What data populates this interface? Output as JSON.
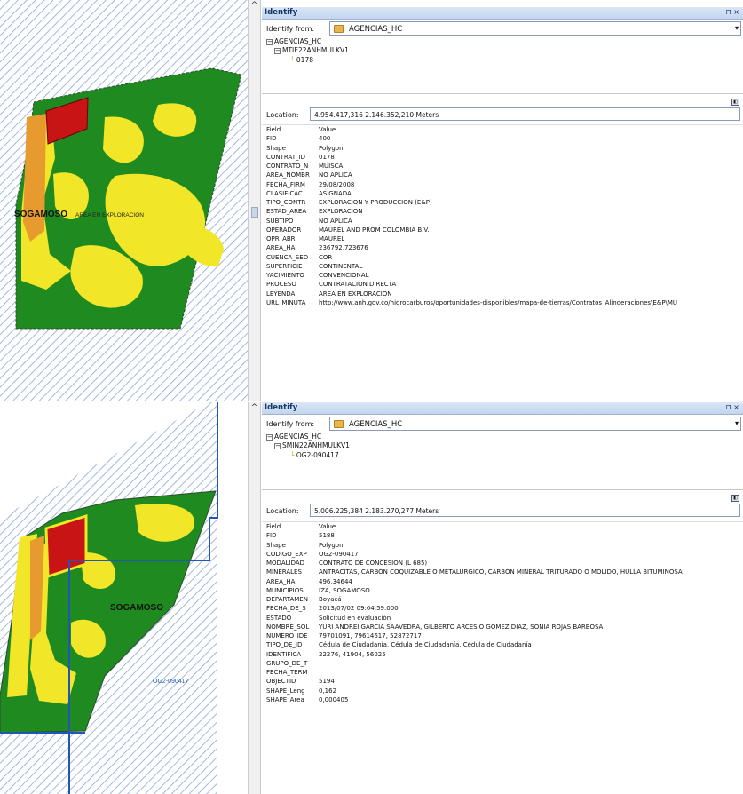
{
  "top": {
    "map": {
      "place_label": "SOGAMOSO",
      "area_label": "AREA EN EXPLORACION"
    },
    "panel": {
      "title": "Identify",
      "pin": "⊓ ×",
      "identify_from_label": "Identify from:",
      "identify_from_value": "AGENCIAS_HC",
      "tree": {
        "root": "AGENCIAS_HC",
        "child": "MTIE22ANHMULKV1",
        "leaf": "0178"
      },
      "location_label": "Location:",
      "location_value": "4.954.417,316  2.146.352,210 Meters",
      "grid_header": {
        "field": "Field",
        "value": "Value"
      },
      "rows": [
        {
          "field": "FID",
          "value": "400"
        },
        {
          "field": "Shape",
          "value": "Polygon"
        },
        {
          "field": "CONTRAT_ID",
          "value": "0178"
        },
        {
          "field": "CONTRATO_N",
          "value": "MUISCA"
        },
        {
          "field": "AREA_NOMBR",
          "value": "NO APLICA"
        },
        {
          "field": "FECHA_FIRM",
          "value": "29/08/2008"
        },
        {
          "field": "CLASIFICAC",
          "value": "ASIGNADA"
        },
        {
          "field": "TIPO_CONTR",
          "value": "EXPLORACION Y PRODUCCION (E&P)"
        },
        {
          "field": "ESTAD_AREA",
          "value": "EXPLORACION"
        },
        {
          "field": "SUBTIPO",
          "value": "NO APLICA"
        },
        {
          "field": "OPERADOR",
          "value": "MAUREL AND PROM COLOMBIA B.V."
        },
        {
          "field": "OPR_ABR",
          "value": "MAUREL"
        },
        {
          "field": "AREA_HA",
          "value": "236792,723676"
        },
        {
          "field": "CUENCA_SED",
          "value": "COR"
        },
        {
          "field": "SUPERFICIE",
          "value": "CONTINENTAL"
        },
        {
          "field": "YACIMIENTO",
          "value": "CONVENCIONAL"
        },
        {
          "field": "PROCESO",
          "value": "CONTRATACION DIRECTA"
        },
        {
          "field": "LEYENDA",
          "value": "AREA EN EXPLORACION"
        },
        {
          "field": "URL_MINUTA",
          "value": "http://www.anh.gov.co/hidrocarburos/oportunidades-disponibles/mapa-de-tierras/Contratos_Alinderaciones\\E&P\\MU"
        }
      ]
    }
  },
  "bottom": {
    "map": {
      "place_label": "SOGAMOSO",
      "area_label": "OG2-090417"
    },
    "panel": {
      "title": "Identify",
      "pin": "⊓ ×",
      "identify_from_label": "Identify from:",
      "identify_from_value": "AGENCIAS_HC",
      "tree": {
        "root": "AGENCIAS_HC",
        "child": "SMIN22ANHMULKV1",
        "leaf": "OG2-090417"
      },
      "location_label": "Location:",
      "location_value": "5.006.225,384  2.183.270,277 Meters",
      "grid_header": {
        "field": "Field",
        "value": "Value"
      },
      "rows": [
        {
          "field": "FID",
          "value": "5188"
        },
        {
          "field": "Shape",
          "value": "Polygon"
        },
        {
          "field": "CODIGO_EXP",
          "value": "OG2-090417"
        },
        {
          "field": "MODALIDAD",
          "value": "CONTRATO DE CONCESION (L 685)"
        },
        {
          "field": "MINERALES",
          "value": "ANTRACITAS, CARBÓN COQUIZABLE O METALURGICO, CARBÓN MINERAL TRITURADO O MOLIDO, HULLA BITUMINOSA"
        },
        {
          "field": "AREA_HA",
          "value": "496,34644"
        },
        {
          "field": "MUNICIPIOS",
          "value": "IZA, SOGAMOSO"
        },
        {
          "field": "DEPARTAMEN",
          "value": "Boyacá"
        },
        {
          "field": "FECHA_DE_S",
          "value": "2013/07/02 09:04:59.000"
        },
        {
          "field": "ESTADO",
          "value": "Solicitud en evaluación"
        },
        {
          "field": "NOMBRE_SOL",
          "value": "YURI ANDREI GARCIA SAAVEDRA, GILBERTO ARCESIO GOMEZ DIAZ, SONIA  ROJAS BARBOSA"
        },
        {
          "field": "NUMERO_IDE",
          "value": "79701091, 79614617, 52872717"
        },
        {
          "field": "TIPO_DE_ID",
          "value": "Cédula de Ciudadanía, Cédula de Ciudadanía, Cédula de Ciudadanía"
        },
        {
          "field": "IDENTIFICA",
          "value": "22276, 41904, 56025"
        },
        {
          "field": "GRUPO_DE_T",
          "value": ""
        },
        {
          "field": "FECHA_TERM",
          "value": ""
        },
        {
          "field": "OBJECTID",
          "value": "5194"
        },
        {
          "field": "SHAPE_Leng",
          "value": "0,162"
        },
        {
          "field": "SHAPE_Area",
          "value": "0,000405"
        }
      ]
    }
  }
}
